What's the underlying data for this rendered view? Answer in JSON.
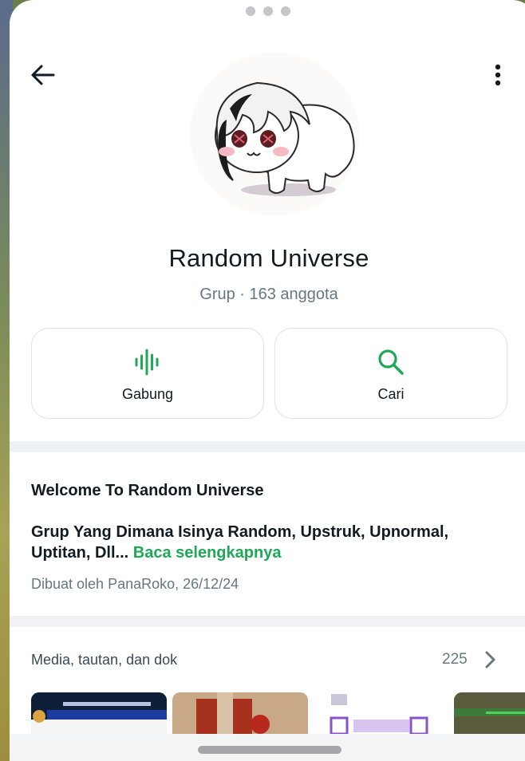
{
  "header": {
    "back_icon": "arrow-left-icon",
    "more_icon": "more-vertical-icon"
  },
  "group": {
    "name": "Random Universe",
    "meta": "Grup · 163 anggota"
  },
  "actions": [
    {
      "label": "Gabung",
      "icon": "audio-wave-icon"
    },
    {
      "label": "Cari",
      "icon": "search-icon"
    }
  ],
  "description": {
    "title": "Welcome To Random Universe",
    "body": "Grup Yang Dimana Isinya Random, Upstruk, Upnormal, Uptitan, Dll...",
    "read_more": "Baca selengkapnya",
    "created_by": "Dibuat oleh PanaRoko, 26/12/24"
  },
  "media": {
    "label": "Media, tautan, dan dok",
    "count": "225"
  },
  "colors": {
    "accent": "#1fa855",
    "text_primary": "#111b21",
    "text_secondary": "#667781"
  }
}
